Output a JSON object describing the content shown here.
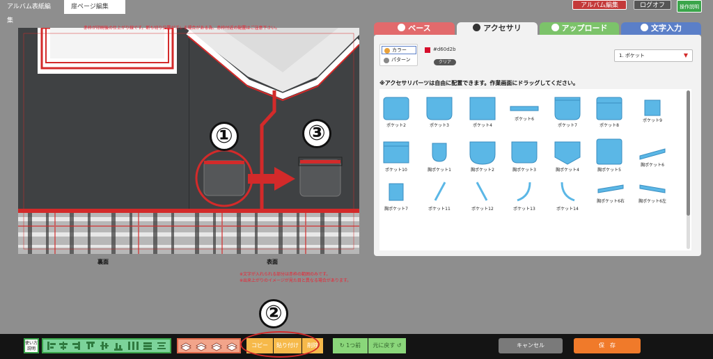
{
  "top_tabs": [
    {
      "label": "アルバム表紙編集"
    },
    {
      "label": "扉ページ編集"
    }
  ],
  "top_buttons": {
    "album_edit": "アルバム編集",
    "logout": "ログオフ",
    "manual": "操作説明"
  },
  "canvas": {
    "top_note": "赤枠が印刷後の仕上がり線です。断ち切り位置がズレる場合がある為、赤枠付近の配置はご注意下さい。",
    "back_label": "裏面",
    "front_label": "表面",
    "bottom_note_1": "※文字が入れられる部分は赤枠の範囲のみです。",
    "bottom_note_2": "※出来上がりのイメージが見た目と異なる場合があります。",
    "step1": "①",
    "step2": "②",
    "step3": "③"
  },
  "panel": {
    "tabs": [
      {
        "label": "ベース",
        "color": "#e26a6c"
      },
      {
        "label": "アクセサリ",
        "color": "#ffffff"
      },
      {
        "label": "アップロード",
        "color": "#7cc36a"
      },
      {
        "label": "文字入力",
        "color": "#5b7fc8"
      }
    ],
    "color_option": "カラー",
    "pattern_option": "パターン",
    "color_hex": "#d60d2b",
    "clear_button": "クリア",
    "select_value": "1. ポケット",
    "instruction": "※アクセサリパーツは自由に配置できます。作業画面にドラッグしてください。",
    "items": [
      {
        "label": "ポケット2"
      },
      {
        "label": "ポケット3"
      },
      {
        "label": "ポケット4"
      },
      {
        "label": "ポケット6"
      },
      {
        "label": "ポケット7"
      },
      {
        "label": "ポケット8"
      },
      {
        "label": "ポケット9"
      },
      {
        "label": "ポケット10"
      },
      {
        "label": "胸ポケット1"
      },
      {
        "label": "胸ポケット2"
      },
      {
        "label": "胸ポケット3"
      },
      {
        "label": "胸ポケット4"
      },
      {
        "label": "胸ポケット5"
      },
      {
        "label": "胸ポケット6"
      },
      {
        "label": "胸ポケット7"
      },
      {
        "label": "ポケット11"
      },
      {
        "label": "ポケット12"
      },
      {
        "label": "ポケット13"
      },
      {
        "label": "ポケット14"
      },
      {
        "label": "胸ポケット6右"
      },
      {
        "label": "胸ポケット6左"
      }
    ]
  },
  "bottom": {
    "help": "使い方説明",
    "copy": "コピー",
    "paste": "貼り付け",
    "delete": "削除",
    "undo": "1つ前",
    "redo": "元に戻す",
    "cancel": "キャンセル",
    "save": "保　存"
  }
}
